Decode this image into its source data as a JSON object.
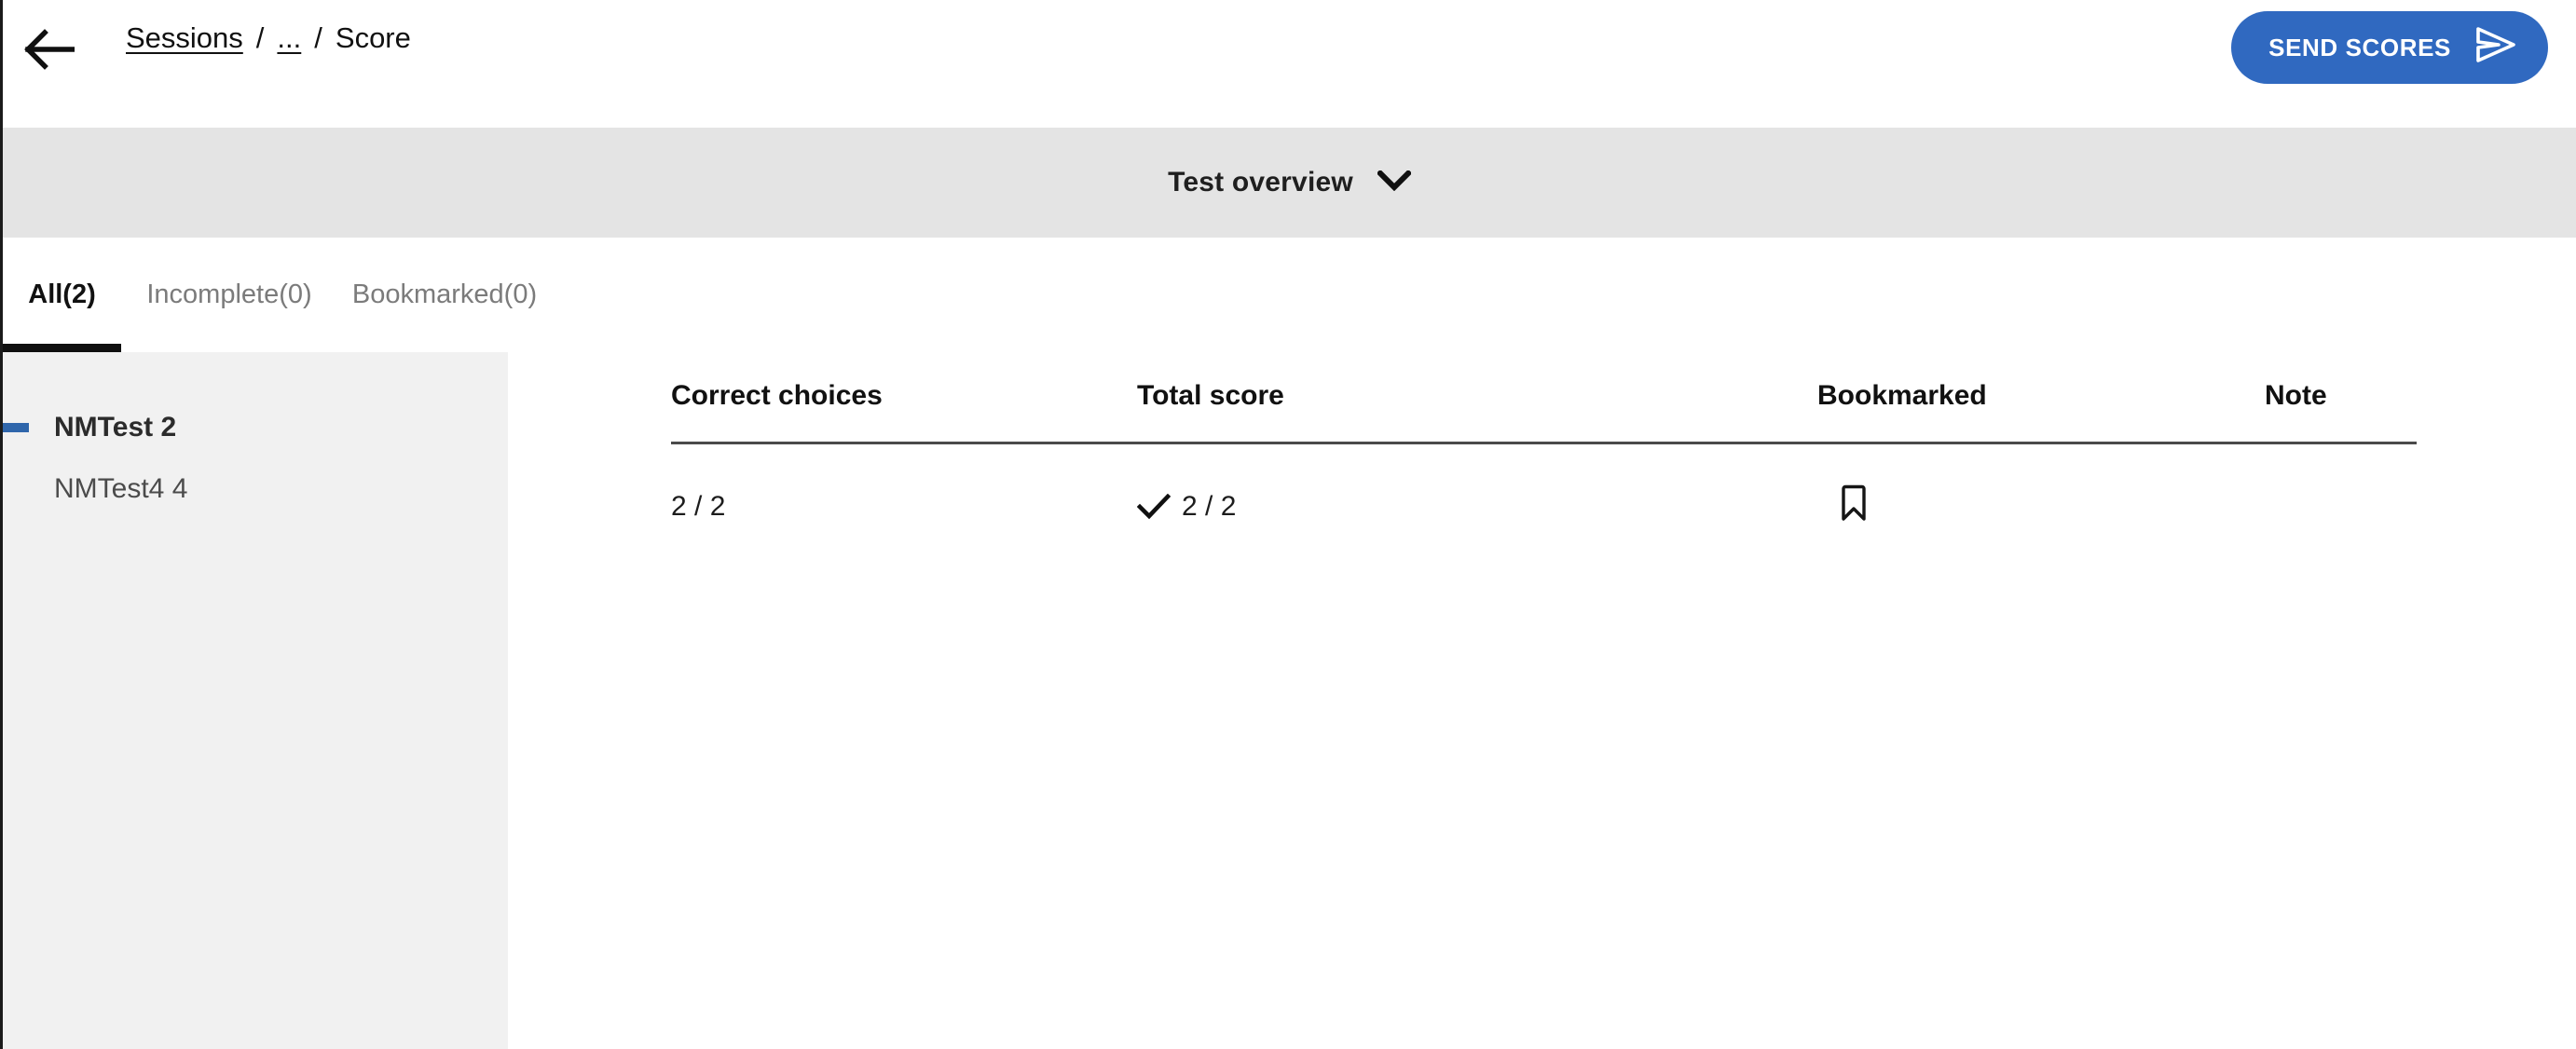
{
  "theme": {
    "accent_blue": "#3069c0",
    "marker_blue": "#2f66ab",
    "overview_bar_bg": "#e4e4e4",
    "sidebar_bg": "#f1f1f1",
    "active_tab_underline": "#101010",
    "divider": "#4a4a4a"
  },
  "topbar": {
    "back_icon": "arrow-left-icon",
    "breadcrumb": {
      "root": "Sessions",
      "separator": "/",
      "ellipsis": "...",
      "current": "Score"
    },
    "send_scores": {
      "label": "SEND SCORES",
      "icon": "send-icon"
    }
  },
  "overview": {
    "label": "Test overview",
    "icon": "chevron-down-icon"
  },
  "tabs": [
    {
      "label": "All(2)",
      "active": true
    },
    {
      "label": "Incomplete(0)",
      "active": false
    },
    {
      "label": "Bookmarked(0)",
      "active": false
    }
  ],
  "sidebar": {
    "items": [
      {
        "label": "NMTest 2",
        "active": true
      },
      {
        "label": "NMTest4 4",
        "active": false
      }
    ]
  },
  "table": {
    "headers": {
      "correct_choices": "Correct choices",
      "total_score": "Total score",
      "bookmarked": "Bookmarked",
      "note": "Note"
    },
    "rows": [
      {
        "correct_choices": "2 / 2",
        "total_score": "2 / 2",
        "total_score_icon": "check-icon",
        "bookmarked_icon": "bookmark-outline-icon",
        "note": ""
      }
    ]
  }
}
